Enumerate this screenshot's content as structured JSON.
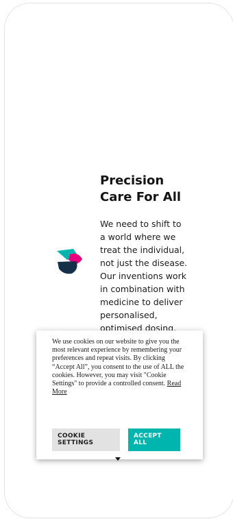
{
  "hero": {
    "title_line1": "Precision",
    "title_line2": "Care For All",
    "body_visible": "We need to shift to a world where we treat the individual, not just the disease. Our inventions work in combination with medicine to deliver personalised, optimised dosing, improving"
  },
  "logo": {
    "icon": "brand-logo-icon",
    "colors": {
      "teal": "#00b5ad",
      "magenta": "#e6007e",
      "navy": "#17304a"
    }
  },
  "cookie_banner": {
    "text": "We use cookies on our website to give you the most relevant experience by remembering your preferences and repeat visits. By clicking “Accept All”, you consent to the use of ALL the cookies. However, you may visit \"Cookie Settings\" to provide a controlled consent.",
    "read_more_label": "Read More",
    "settings_line1": "COOKIE",
    "settings_line2": "SETTINGS",
    "accept_line1": "ACCEPT",
    "accept_line2": "ALL",
    "accent_color": "#00b5ad",
    "settings_bg_color": "#e2e2e2"
  }
}
